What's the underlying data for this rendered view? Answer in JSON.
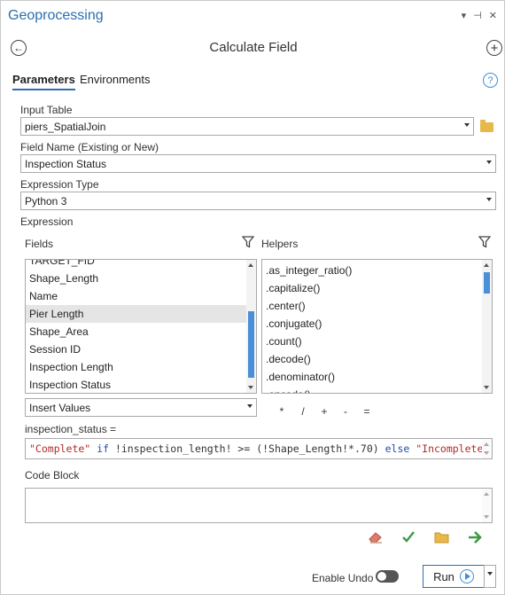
{
  "pane": {
    "title": "Geoprocessing",
    "menu_glyph": "▾",
    "pin_glyph": "⊣",
    "close_glyph": "✕"
  },
  "tool": {
    "title": "Calculate Field",
    "back_glyph": "←",
    "add_glyph": "+"
  },
  "tabs": [
    {
      "label": "Parameters",
      "active": true
    },
    {
      "label": "Environments",
      "active": false
    }
  ],
  "help_glyph": "?",
  "params": {
    "input_table": {
      "label": "Input Table",
      "value": "piers_SpatialJoin"
    },
    "field_name": {
      "label": "Field Name (Existing or New)",
      "value": "Inspection Status"
    },
    "expression_type": {
      "label": "Expression Type",
      "value": "Python 3"
    },
    "expression_label": "Expression"
  },
  "fields": {
    "label": "Fields",
    "items": [
      "TARGET_FID",
      "Shape_Length",
      "Name",
      "Pier Length",
      "Shape_Area",
      "Session ID",
      "Inspection Length",
      "Inspection Status"
    ],
    "selected": "Pier Length"
  },
  "helpers": {
    "label": "Helpers",
    "items": [
      ".as_integer_ratio()",
      ".capitalize()",
      ".center()",
      ".conjugate()",
      ".count()",
      ".decode()",
      ".denominator()",
      ".encode()"
    ]
  },
  "insert_values": {
    "label": "Insert Values"
  },
  "operators": [
    "*",
    "/",
    "+",
    "-",
    "="
  ],
  "expression": {
    "target": "inspection_status =",
    "parts": {
      "s1": "\"Complete\"",
      "k1": " if ",
      "m1": "!inspection_length! >= (!Shape_Length!*.70) ",
      "k2": "else ",
      "s2": "\"Incomplete\""
    }
  },
  "code_block": {
    "label": "Code Block",
    "value": ""
  },
  "footer": {
    "enable_undo_label": "Enable Undo",
    "enable_undo_on": false,
    "run_label": "Run"
  },
  "colors": {
    "accent": "#2a6fb0",
    "thumb": "#4a90d9",
    "string": "#b22a2a",
    "keyword": "#1f4fa6"
  }
}
